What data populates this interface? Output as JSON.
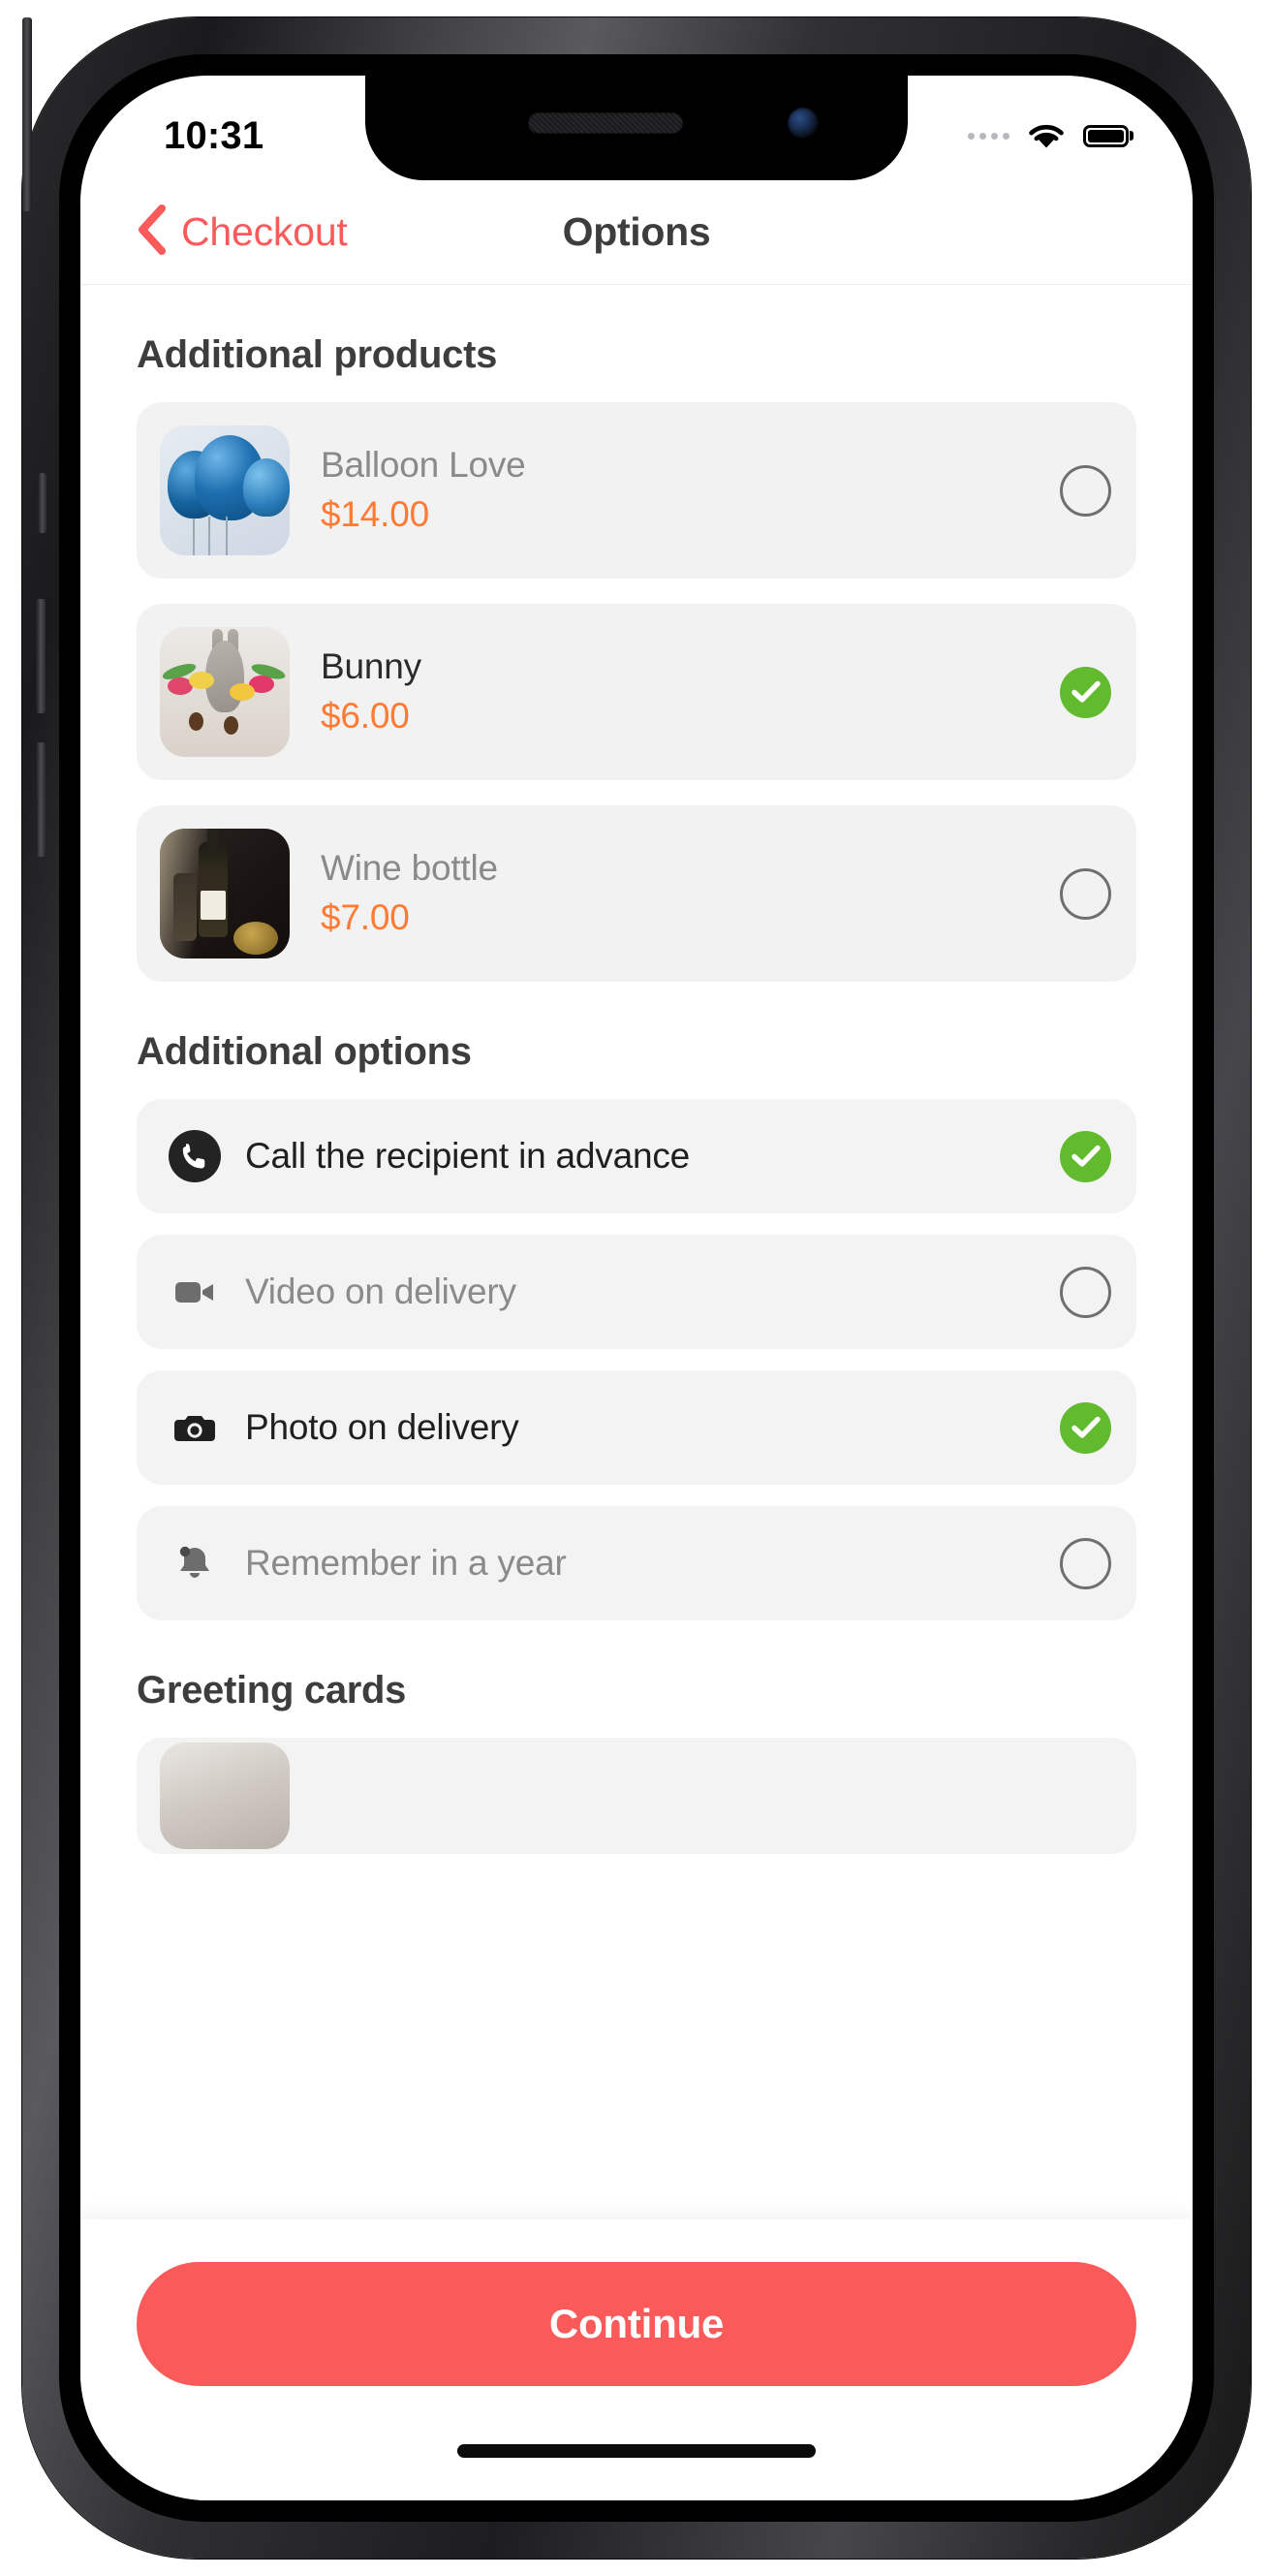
{
  "status_bar": {
    "time": "10:31",
    "signal_icon": "signal-dots-icon",
    "wifi_icon": "wifi-icon",
    "battery_icon": "battery-full-icon"
  },
  "nav": {
    "back_label": "Checkout",
    "back_icon": "chevron-left-icon",
    "title": "Options"
  },
  "sections": {
    "products_title": "Additional products",
    "options_title": "Additional options",
    "cards_title": "Greeting cards"
  },
  "products": [
    {
      "name": "Balloon Love",
      "price": "$14.00",
      "selected": false,
      "thumb": "balloon-photo"
    },
    {
      "name": "Bunny",
      "price": "$6.00",
      "selected": true,
      "thumb": "bunny-photo"
    },
    {
      "name": "Wine bottle",
      "price": "$7.00",
      "selected": false,
      "thumb": "wine-photo"
    }
  ],
  "options": [
    {
      "label": "Call the recipient in advance",
      "icon": "phone-icon",
      "selected": true
    },
    {
      "label": "Video on delivery",
      "icon": "video-icon",
      "selected": false
    },
    {
      "label": "Photo on delivery",
      "icon": "camera-icon",
      "selected": true
    },
    {
      "label": "Remember in a year",
      "icon": "bell-icon",
      "selected": false
    }
  ],
  "bottom": {
    "continue_label": "Continue"
  },
  "colors": {
    "accent_coral": "#FB5A5A",
    "price_orange": "#FF7A33",
    "check_green": "#62BB2E",
    "card_gray": "#F2F2F2",
    "text_dark": "#3D3D3D",
    "text_muted": "#8A8A8A"
  }
}
